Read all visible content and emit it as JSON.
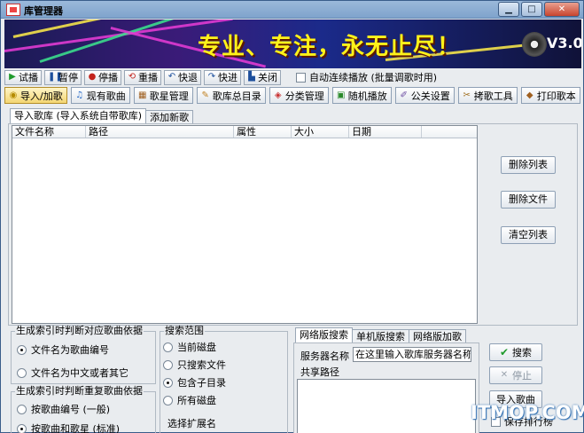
{
  "window": {
    "title": "库管理器",
    "min_glyph": "▁",
    "max_glyph": "□",
    "close_glyph": "✕"
  },
  "banner": {
    "slogan": "专业、专注，永无止尽！",
    "version": "V3.0"
  },
  "controls": {
    "buttons": [
      {
        "label": "试播",
        "icon": "play-icon",
        "glyph": "▶",
        "color": "#1f9a2c"
      },
      {
        "label": "暂停",
        "icon": "pause-icon",
        "glyph": "❚❚",
        "color": "#1d4f9c"
      },
      {
        "label": "停播",
        "icon": "stop-icon",
        "glyph": "●",
        "color": "#c3231d"
      },
      {
        "label": "重播",
        "icon": "replay-icon",
        "glyph": "⟲",
        "color": "#c3231d"
      },
      {
        "label": "快退",
        "icon": "rewind-icon",
        "glyph": "↶",
        "color": "#1d4f9c"
      },
      {
        "label": "快进",
        "icon": "fast-forward-icon",
        "glyph": "↷",
        "color": "#1d4f9c"
      },
      {
        "label": "关闭",
        "icon": "close-player-icon",
        "glyph": "▙",
        "color": "#1d4f9c"
      }
    ],
    "auto_play_label": "自动连续播放 (批量调歌时用)"
  },
  "toolbar": {
    "items": [
      {
        "label": "导入/加歌",
        "icon": "disc-import-icon",
        "glyph": "◉",
        "color": "#b58b00",
        "active": true
      },
      {
        "label": "现有歌曲",
        "icon": "music-note-icon",
        "glyph": "♫",
        "color": "#2a6cc8",
        "active": false
      },
      {
        "label": "歌星管理",
        "icon": "singer-book-icon",
        "glyph": "▦",
        "color": "#a06020",
        "active": false
      },
      {
        "label": "歌库总目录",
        "icon": "catalog-icon",
        "glyph": "✎",
        "color": "#c08020",
        "active": false
      },
      {
        "label": "分类管理",
        "icon": "category-icon",
        "glyph": "◈",
        "color": "#c83030",
        "active": false
      },
      {
        "label": "随机播放",
        "icon": "shuffle-icon",
        "glyph": "▣",
        "color": "#2a8a2a",
        "active": false
      },
      {
        "label": "公关设置",
        "icon": "settings-icon",
        "glyph": "✐",
        "color": "#6a4aa0",
        "active": false
      },
      {
        "label": "拷歌工具",
        "icon": "copy-tool-icon",
        "glyph": "✂",
        "color": "#a07020",
        "active": false
      },
      {
        "label": "打印歌本",
        "icon": "print-icon",
        "glyph": "◆",
        "color": "#a06020",
        "active": false
      }
    ]
  },
  "import_tabs": [
    "导入歌库 (导入系统自带歌库)",
    "添加新歌"
  ],
  "file_list": {
    "columns": [
      "文件名称",
      "路径",
      "属性",
      "大小",
      "日期"
    ]
  },
  "list_actions": [
    "删除列表",
    "删除文件",
    "清空列表"
  ],
  "index_group": {
    "title": "生成索引时判断对应歌曲依据",
    "options": [
      {
        "label": "文件名为歌曲编号",
        "selected": true
      },
      {
        "label": "文件名为中文或者其它",
        "selected": false
      }
    ]
  },
  "dup_group": {
    "title": "生成索引时判断重复歌曲依据",
    "options": [
      {
        "label": "按歌曲编号 (一般)",
        "selected": false
      },
      {
        "label": "按歌曲和歌星 (标准)",
        "selected": true
      }
    ]
  },
  "search_scope": {
    "title": "搜索范围",
    "options": [
      {
        "label": "当前磁盘",
        "selected": false
      },
      {
        "label": "只搜索文件",
        "selected": false
      },
      {
        "label": "包含子目录",
        "selected": true
      },
      {
        "label": "所有磁盘",
        "selected": false
      }
    ],
    "ext_label": "选择扩展名"
  },
  "network": {
    "tabs": [
      "网络版搜索",
      "单机版搜索",
      "网络版加歌"
    ],
    "server_label": "服务器名称",
    "server_value": "在这里输入歌库服务器名称",
    "share_label": "共享路径"
  },
  "right_actions": [
    {
      "label": "搜索",
      "icon": "checkmark-icon",
      "glyph": "✔",
      "color": "#1f9a2c",
      "disabled": false
    },
    {
      "label": "停止",
      "icon": "stop-x-icon",
      "glyph": "✕",
      "color": "#9aa3ad",
      "disabled": true
    },
    {
      "label": "导入歌曲",
      "icon": "",
      "glyph": "",
      "color": "#000000",
      "disabled": false
    }
  ],
  "sort_checkbox_label": "保存排行榜",
  "watermark": "ITMOP.COM"
}
